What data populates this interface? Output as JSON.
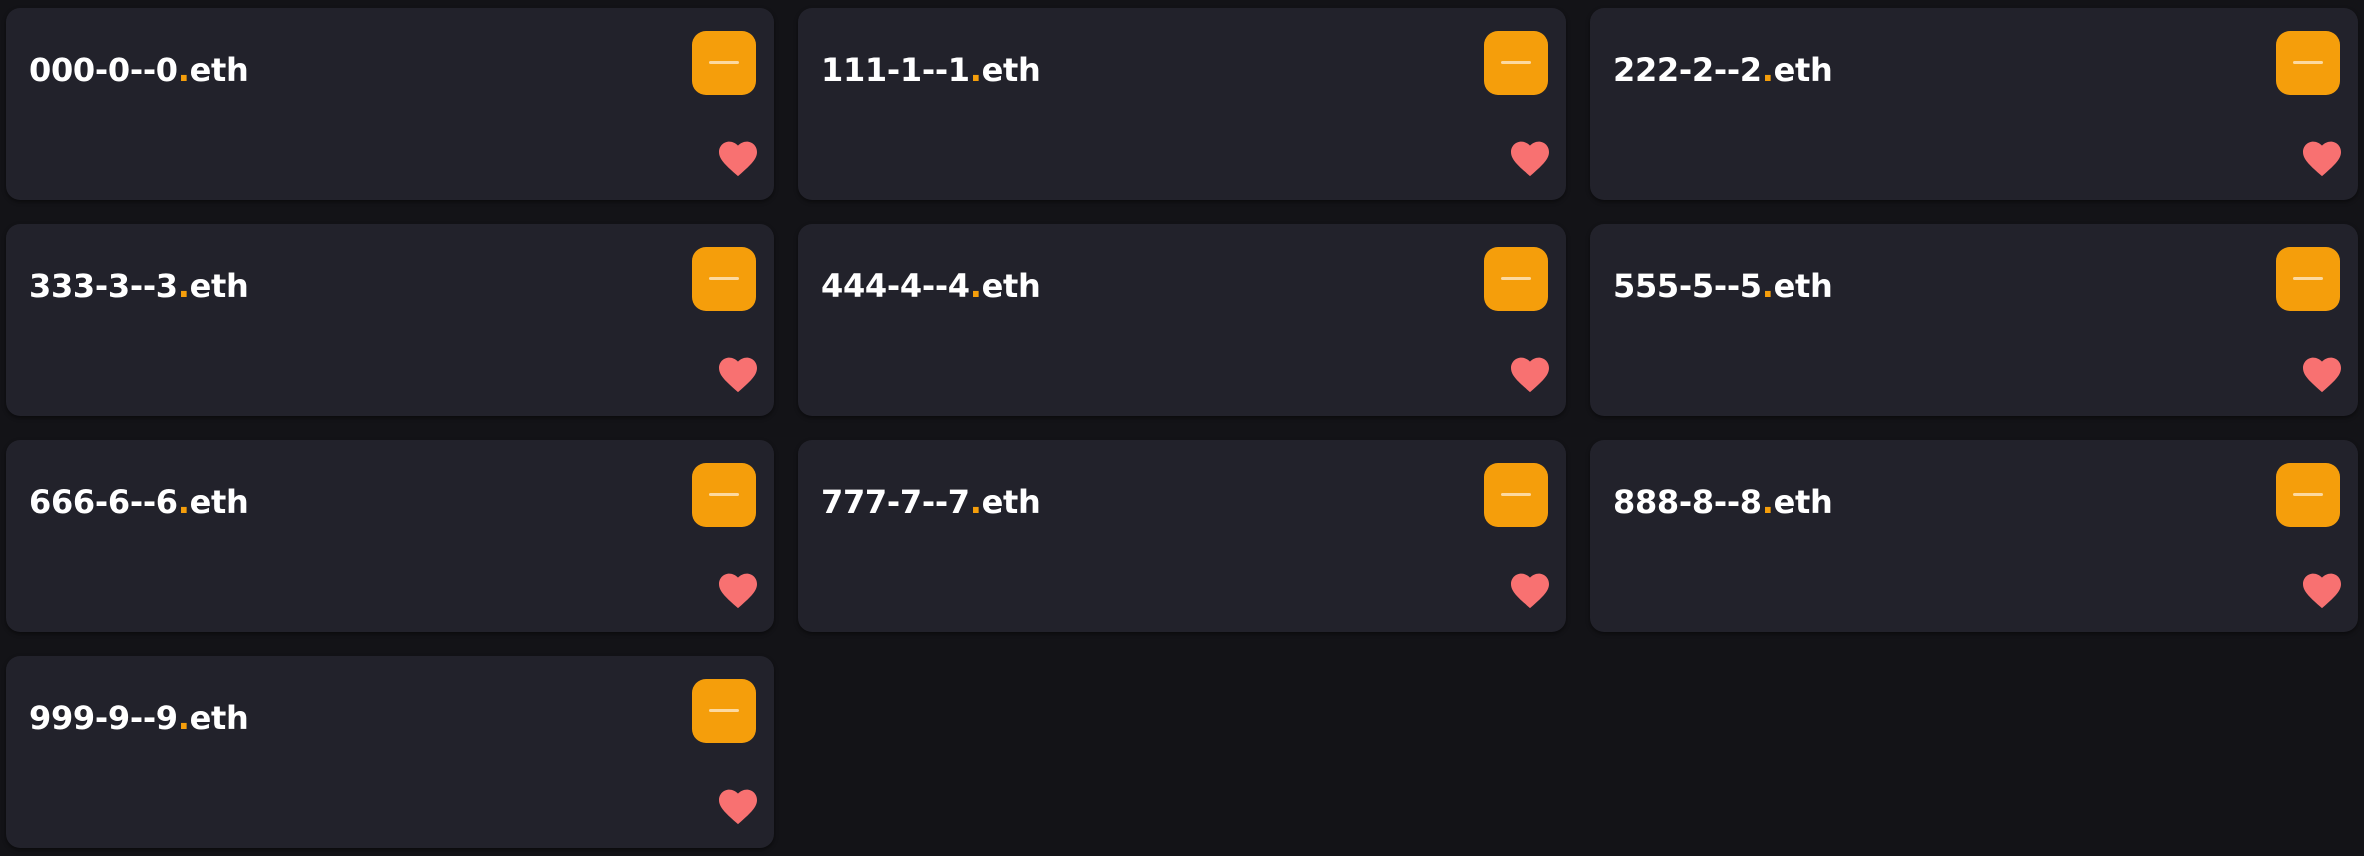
{
  "colors": {
    "background": "#131317",
    "card": "#22222b",
    "accent": "#f59e0b",
    "heart": "#f87171",
    "text": "#ffffff"
  },
  "cards": [
    {
      "label": "000-0--0",
      "tld": "eth",
      "button_icon": "minus-icon",
      "favorite_icon": "heart-icon"
    },
    {
      "label": "111-1--1",
      "tld": "eth",
      "button_icon": "minus-icon",
      "favorite_icon": "heart-icon"
    },
    {
      "label": "222-2--2",
      "tld": "eth",
      "button_icon": "minus-icon",
      "favorite_icon": "heart-icon"
    },
    {
      "label": "333-3--3",
      "tld": "eth",
      "button_icon": "minus-icon",
      "favorite_icon": "heart-icon"
    },
    {
      "label": "444-4--4",
      "tld": "eth",
      "button_icon": "minus-icon",
      "favorite_icon": "heart-icon"
    },
    {
      "label": "555-5--5",
      "tld": "eth",
      "button_icon": "minus-icon",
      "favorite_icon": "heart-icon"
    },
    {
      "label": "666-6--6",
      "tld": "eth",
      "button_icon": "minus-icon",
      "favorite_icon": "heart-icon"
    },
    {
      "label": "777-7--7",
      "tld": "eth",
      "button_icon": "minus-icon",
      "favorite_icon": "heart-icon"
    },
    {
      "label": "888-8--8",
      "tld": "eth",
      "button_icon": "minus-icon",
      "favorite_icon": "heart-icon"
    },
    {
      "label": "999-9--9",
      "tld": "eth",
      "button_icon": "minus-icon",
      "favorite_icon": "heart-icon"
    }
  ]
}
